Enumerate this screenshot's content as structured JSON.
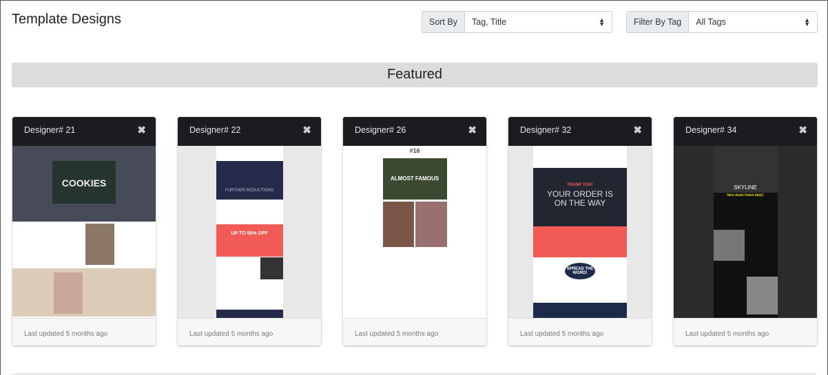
{
  "header": {
    "title": "Template Designs"
  },
  "sort": {
    "label": "Sort By",
    "value": "Tag, Title"
  },
  "filter": {
    "label": "Filter By Tag",
    "value": "All Tags"
  },
  "section": {
    "title": "Featured"
  },
  "cards": [
    {
      "title": "Designer# 21",
      "updated": "Last updated 5 months ago",
      "preview": [
        "COOKIES"
      ]
    },
    {
      "title": "Designer# 22",
      "updated": "Last updated 5 months ago",
      "preview": [
        "FURTHER REDUCTIONS",
        "UP TO 50% OFF"
      ]
    },
    {
      "title": "Designer# 26",
      "updated": "Last updated 5 months ago",
      "preview": [
        "#16",
        "ALMOST FAMOUS"
      ]
    },
    {
      "title": "Designer# 32",
      "updated": "Last updated 5 months ago",
      "preview": [
        "THANK YOU!",
        "YOUR ORDER IS ON THE WAY",
        "SPREAD THE WORD!"
      ]
    },
    {
      "title": "Designer# 34",
      "updated": "Last updated 5 months ago",
      "preview": [
        "SKYLINE",
        "New deals listed daily!"
      ]
    }
  ],
  "icons": {
    "close": "close-icon",
    "sort_arrows": "sort-arrows-icon"
  }
}
